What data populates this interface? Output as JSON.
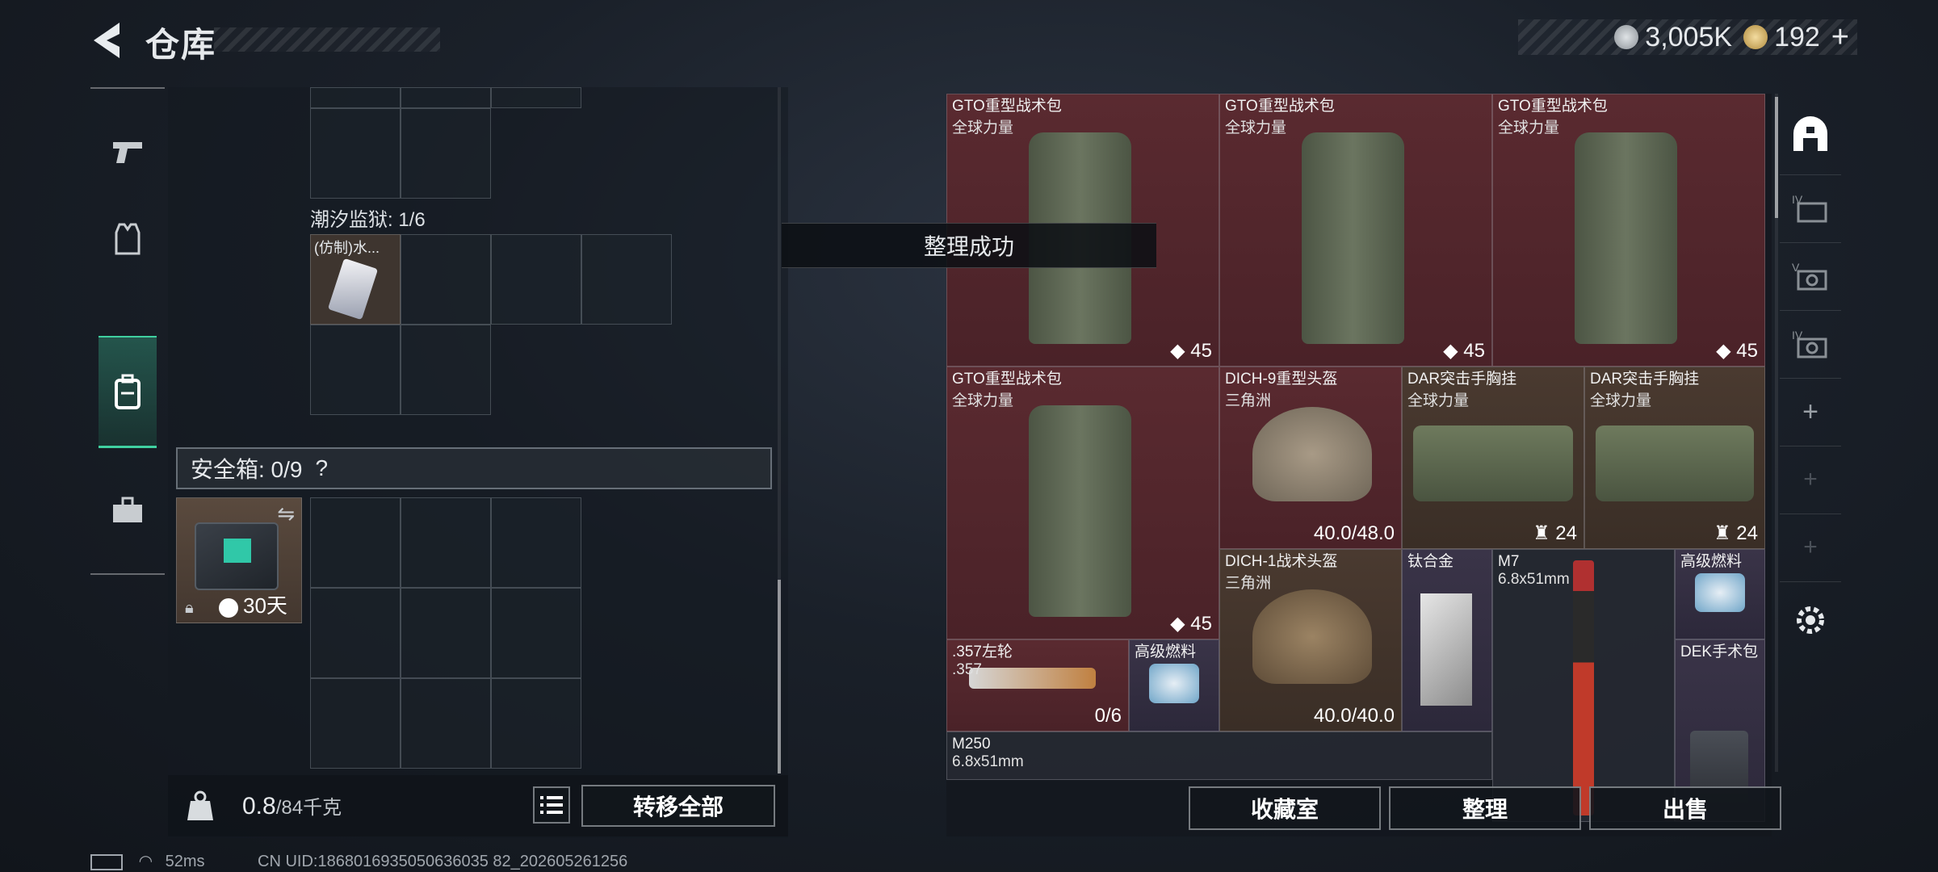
{
  "header": {
    "title": "仓库"
  },
  "currency": {
    "silver": "3,005K",
    "gold": "192",
    "add": "+"
  },
  "left_nav": [
    "weapons",
    "armor",
    "backpack",
    "tools"
  ],
  "containers": {
    "tidal_prison_label": "潮汐监狱: 1/6",
    "tidal_item_name": "(仿制)水...",
    "safebox_label": "安全箱: 0/9",
    "safebox_help": "?",
    "safebox_days": "30天"
  },
  "weight": {
    "current": "0.8",
    "max": "/84千克"
  },
  "buttons": {
    "transfer_all": "转移全部",
    "collection": "收藏室",
    "organize": "整理",
    "sell": "出售"
  },
  "toast": "整理成功",
  "items": [
    {
      "name": "GTO重型战术包",
      "sub": "全球力量",
      "value": "45",
      "rarity": "red"
    },
    {
      "name": "GTO重型战术包",
      "sub": "全球力量",
      "value": "45",
      "rarity": "red"
    },
    {
      "name": "GTO重型战术包",
      "sub": "全球力量",
      "value": "45",
      "rarity": "red"
    },
    {
      "name": "GTO重型战术包",
      "sub": "全球力量",
      "value": "45",
      "rarity": "red"
    },
    {
      "name": "DICH-9重型头盔",
      "sub": "三角洲",
      "value": "40.0/48.0",
      "rarity": "red"
    },
    {
      "name": "DAR突击手胸挂",
      "sub": "全球力量",
      "value": "24",
      "rarity": "brown"
    },
    {
      "name": "DAR突击手胸挂",
      "sub": "全球力量",
      "value": "24",
      "rarity": "brown"
    },
    {
      "name": "DICH-1战术头盔",
      "sub": "三角洲",
      "value": "40.0/40.0",
      "rarity": "brown"
    },
    {
      "name": "钛合金",
      "sub": "",
      "value": "",
      "rarity": "purple"
    },
    {
      "name": "M7",
      "sub": "6.8x51mm",
      "value": "",
      "rarity": "dark"
    },
    {
      "name": "高级燃料",
      "sub": "",
      "value": "",
      "rarity": "purple"
    },
    {
      "name": ".357左轮",
      "sub": ".357",
      "value": "0/6",
      "rarity": "red"
    },
    {
      "name": "高级燃料",
      "sub": "",
      "value": "",
      "rarity": "purple"
    },
    {
      "name": "DEK手术包",
      "sub": "",
      "value": "",
      "rarity": "purple"
    },
    {
      "name": "M250",
      "sub": "6.8x51mm",
      "value": "",
      "rarity": "dark"
    }
  ],
  "status": {
    "ping": "52ms",
    "uid": "CN UID:1868016935050636035 82_202605261256"
  }
}
